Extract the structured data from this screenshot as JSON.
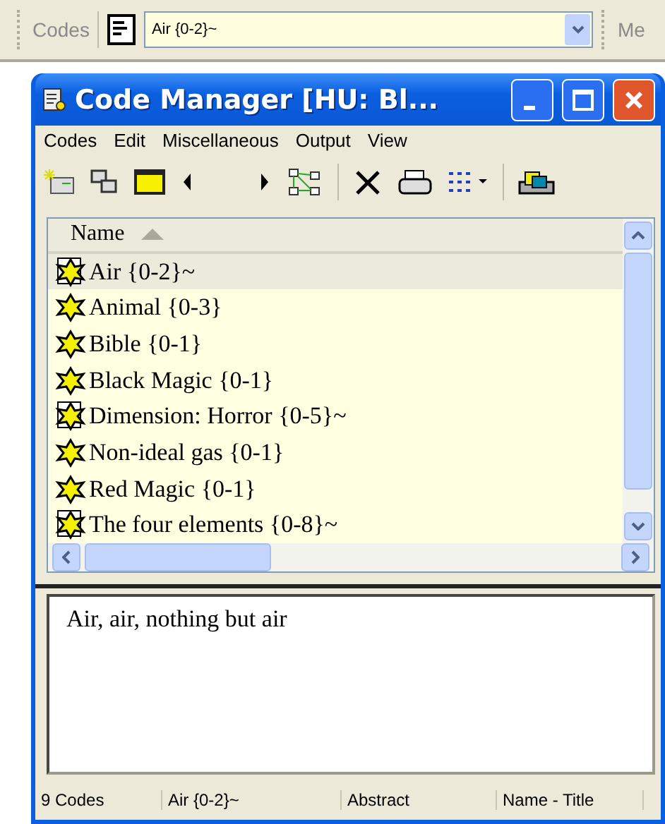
{
  "top_toolbar": {
    "label": "Codes",
    "combo_value": "Air {0-2}~",
    "next_label": "Me"
  },
  "window": {
    "title": "Code Manager [HU: Bl...",
    "menu": [
      "Codes",
      "Edit",
      "Miscellaneous",
      "Output",
      "View"
    ]
  },
  "list": {
    "column": "Name",
    "rows": [
      {
        "label": "Air {0-2}~",
        "selected": true,
        "memo": true
      },
      {
        "label": "Animal {0-3}",
        "selected": false,
        "memo": false
      },
      {
        "label": "Bible {0-1}",
        "selected": false,
        "memo": false
      },
      {
        "label": "Black Magic {0-1}",
        "selected": false,
        "memo": false
      },
      {
        "label": "Dimension: Horror {0-5}~",
        "selected": false,
        "memo": true
      },
      {
        "label": "Non-ideal gas {0-1}",
        "selected": false,
        "memo": false
      },
      {
        "label": "Red Magic {0-1}",
        "selected": false,
        "memo": false
      },
      {
        "label": "The four elements {0-8}~",
        "selected": false,
        "memo": true
      }
    ]
  },
  "memo": "Air, air, nothing but air",
  "status_bar": [
    "9 Codes",
    "Air {0-2}~",
    "Abstract",
    "Name - Title"
  ]
}
